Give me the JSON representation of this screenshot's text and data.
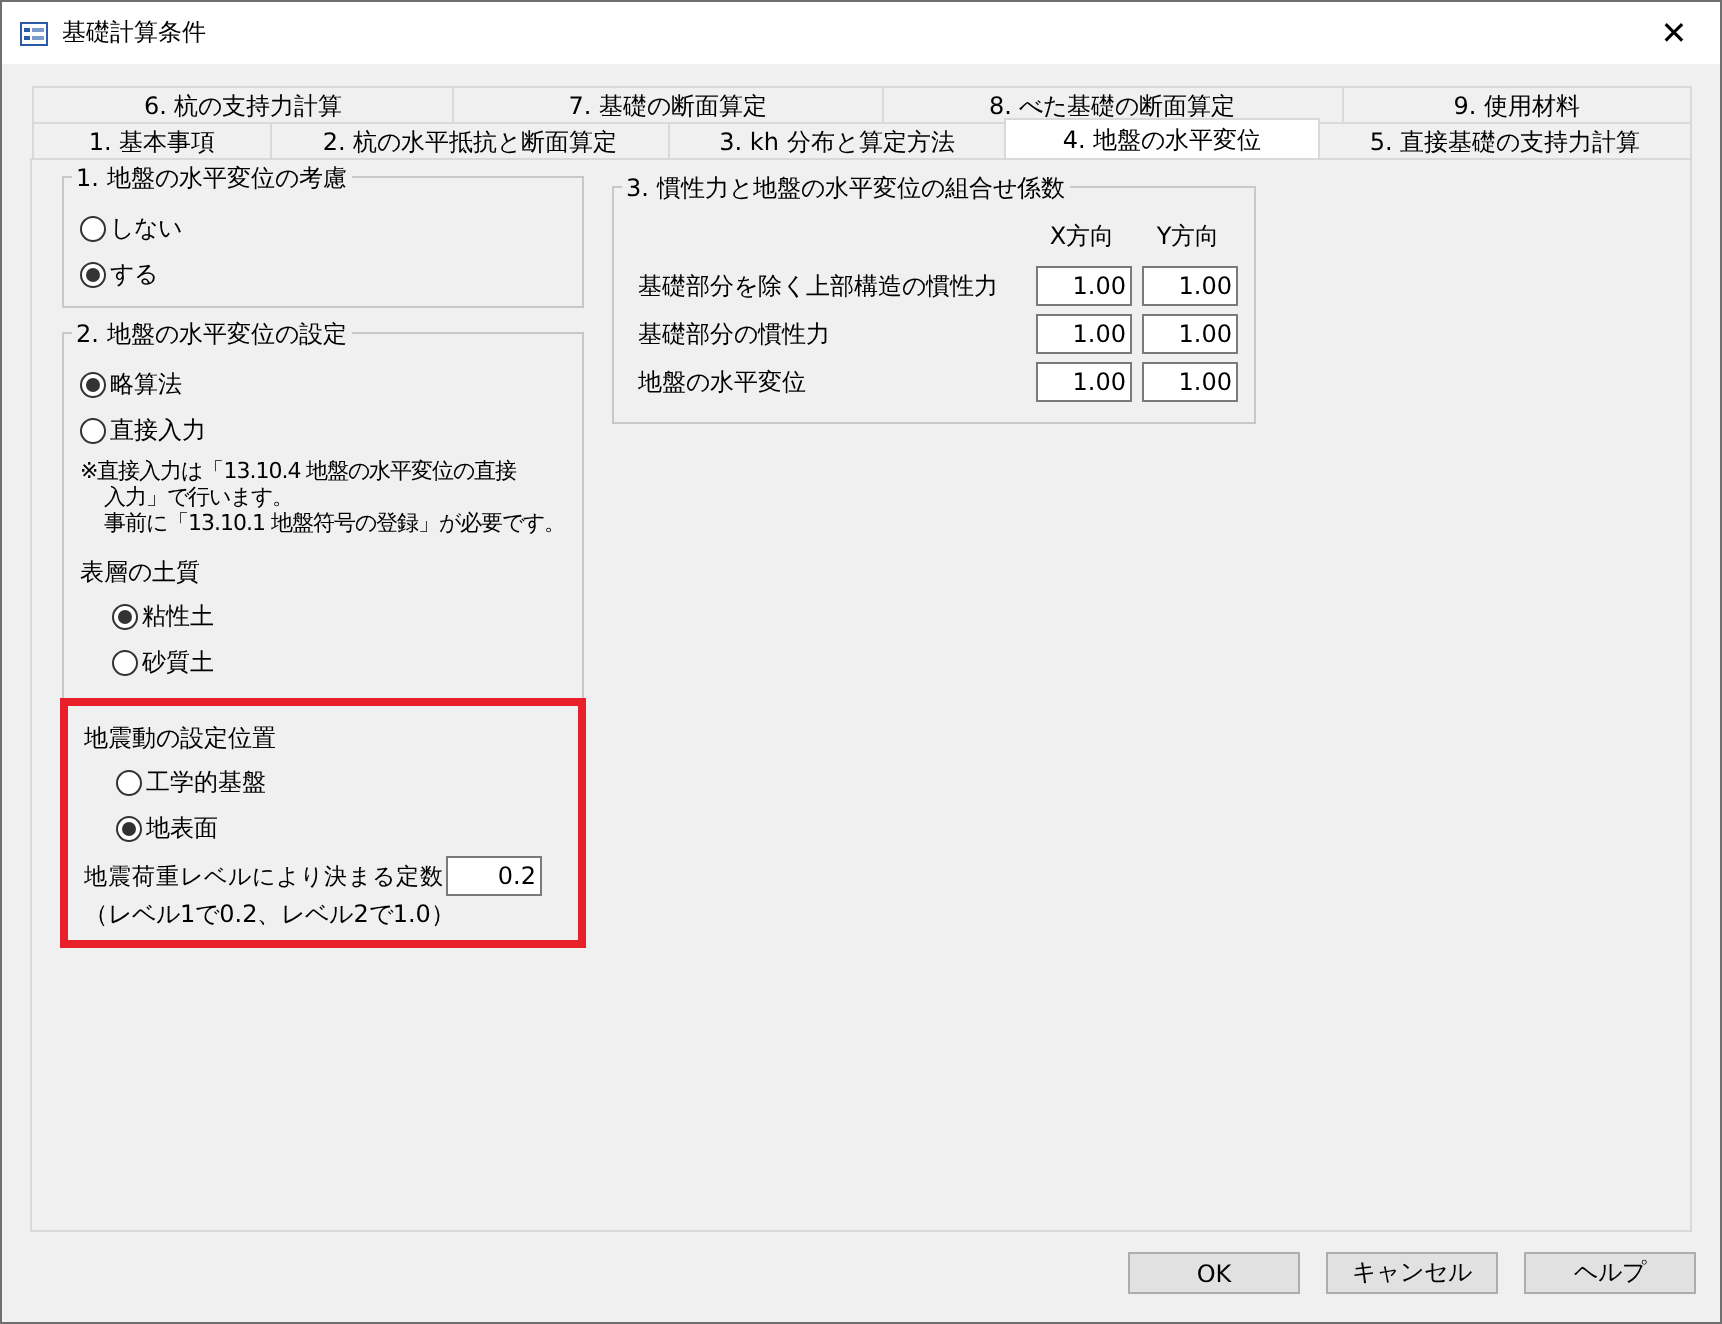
{
  "window": {
    "title": "基礎計算条件",
    "close": "✕"
  },
  "tab_rows": [
    [
      {
        "label": "6. 杭の支持力計算",
        "selected": false
      },
      {
        "label": "7. 基礎の断面算定",
        "selected": false
      },
      {
        "label": "8. べた基礎の断面算定",
        "selected": false
      },
      {
        "label": "9. 使用材料",
        "selected": false
      }
    ],
    [
      {
        "label": "1. 基本事項",
        "selected": false
      },
      {
        "label": "2. 杭の水平抵抗と断面算定",
        "selected": false
      },
      {
        "label": "3. kh 分布と算定方法",
        "selected": false
      },
      {
        "label": "4. 地盤の水平変位",
        "selected": true
      },
      {
        "label": "5. 直接基礎の支持力計算",
        "selected": false
      }
    ]
  ],
  "consider_group": {
    "title": "1. 地盤の水平変位の考慮",
    "options": [
      {
        "label": "しない",
        "selected": false
      },
      {
        "label": "する",
        "selected": true
      }
    ]
  },
  "setting_group": {
    "title": "2. 地盤の水平変位の設定",
    "options": [
      {
        "label": "略算法",
        "selected": true
      },
      {
        "label": "直接入力",
        "selected": false
      }
    ],
    "note": [
      "※直接入力は「13.10.4 地盤の水平変位の直接",
      "入力」で行います。",
      "事前に「13.10.1 地盤符号の登録」が必要です。"
    ],
    "soil": {
      "title": "表層の土質",
      "options": [
        {
          "label": "粘性土",
          "selected": true
        },
        {
          "label": "砂質土",
          "selected": false
        }
      ]
    },
    "seismic": {
      "highlighted": true,
      "title": "地震動の設定位置",
      "options": [
        {
          "label": "工学的基盤",
          "selected": false
        },
        {
          "label": "地表面",
          "selected": true
        }
      ],
      "constant_label": "地震荷重レベルにより決まる定数",
      "constant_value": "0.2",
      "constant_note": "（レベル1で0.2、レベル2で1.0）"
    }
  },
  "coef_group": {
    "title": "3. 慣性力と地盤の水平変位の組合せ係数",
    "columns": [
      "X方向",
      "Y方向"
    ],
    "rows": [
      {
        "label": "基礎部分を除く上部構造の慣性力",
        "values": [
          "1.00",
          "1.00"
        ]
      },
      {
        "label": "基礎部分の慣性力",
        "values": [
          "1.00",
          "1.00"
        ]
      },
      {
        "label": "地盤の水平変位",
        "values": [
          "1.00",
          "1.00"
        ]
      }
    ]
  },
  "buttons": [
    "OK",
    "キャンセル",
    "ヘルプ"
  ]
}
